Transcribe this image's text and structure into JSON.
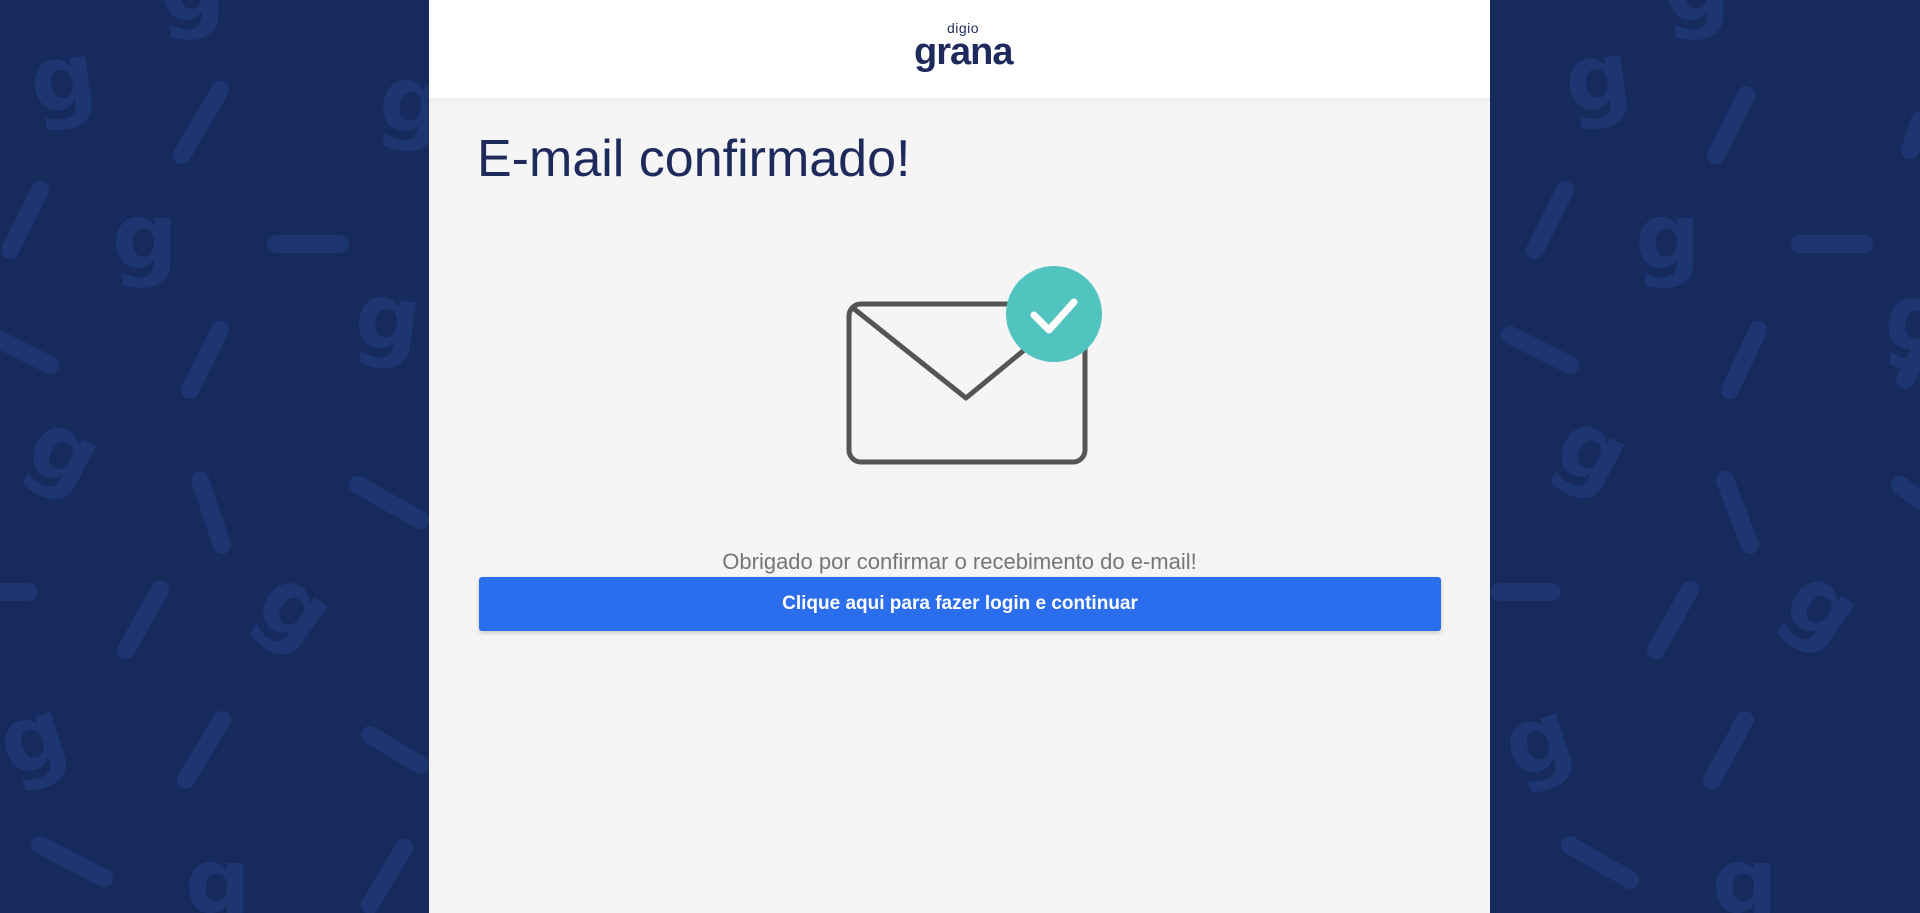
{
  "brand": {
    "logo_small": "digio",
    "logo_big": "grana"
  },
  "page": {
    "title": "E-mail confirmado!",
    "message": "Obrigado por confirmar o recebimento do e-mail!",
    "cta_label": "Clique aqui para fazer login e continuar"
  },
  "icons": {
    "illustration": "envelope-icon",
    "badge": "check-circle-icon"
  },
  "colors": {
    "background": "#162a5e",
    "pattern": "#1d3570",
    "panel": "#f5f5f5",
    "header": "#ffffff",
    "title": "#1d2a5b",
    "message": "#767676",
    "button": "#2a6ded",
    "button_text": "#ffffff",
    "check_badge": "#52c4bf",
    "envelope_stroke": "#555555"
  }
}
